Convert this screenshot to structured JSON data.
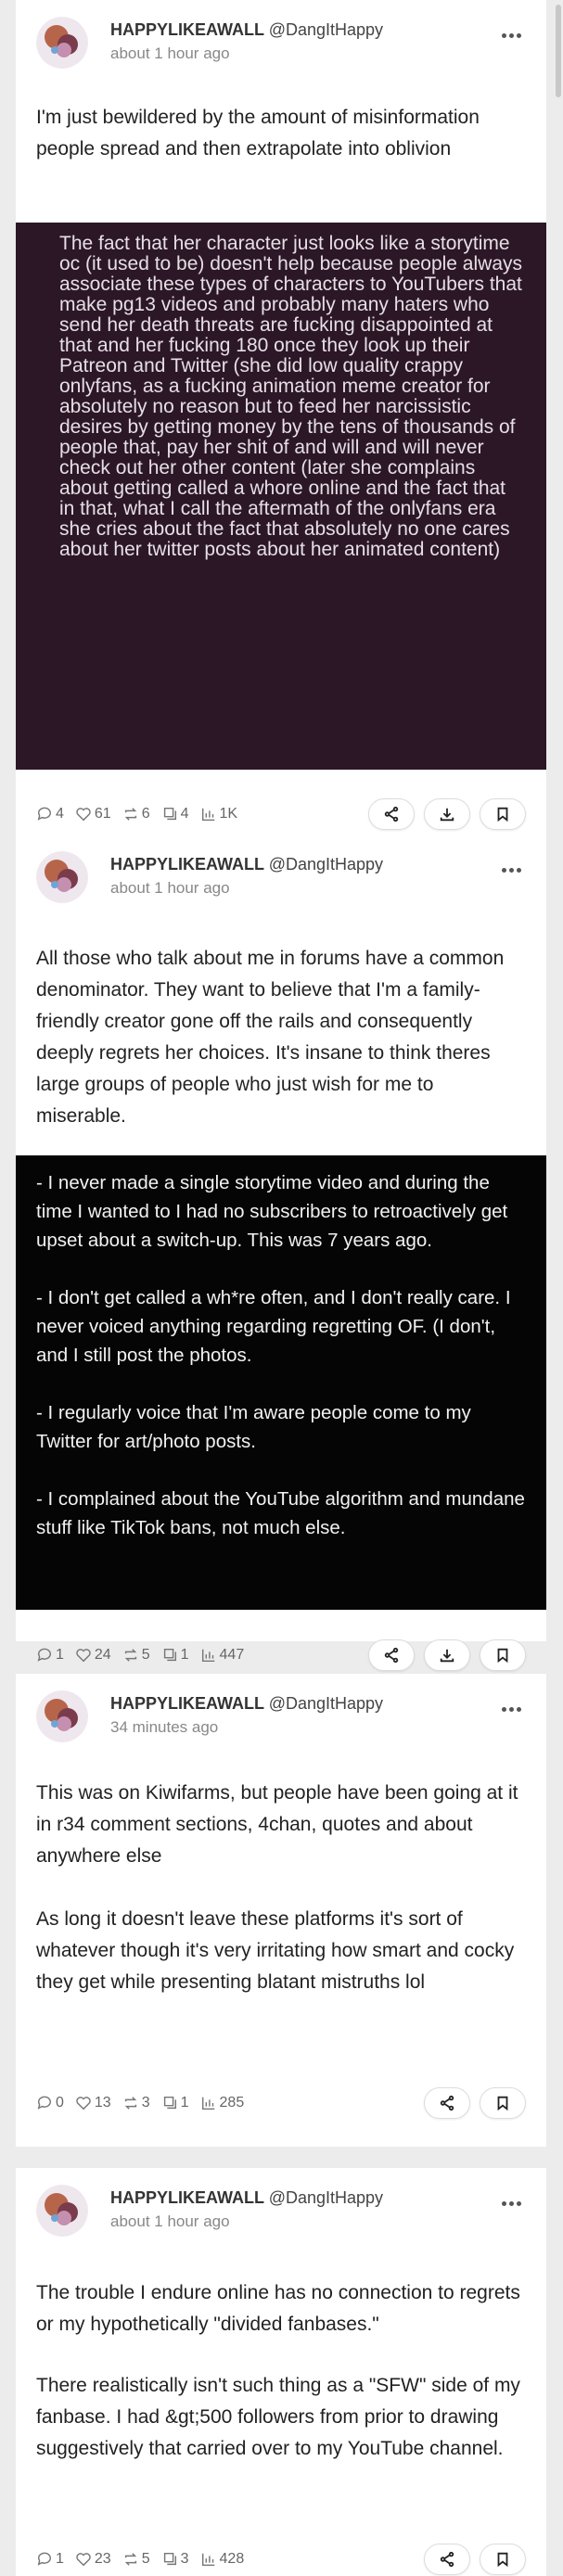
{
  "posts": [
    {
      "username": "HAPPYLIKEAWALL",
      "handle": "@DangItHappy",
      "timestamp": "about 1 hour ago",
      "text": "I'm just bewildered by the amount of misinformation people spread and then extrapolate into oblivion",
      "quote": [
        "The fact that her character just looks like a storytime oc (it used to be) doesn't help because people always associate these types of characters to YouTubers that make pg13 videos and probably many haters who send her death threats are fucking disappointed at that and her fucking 180 once they look up their Patreon and Twitter (she did low quality crappy onlyfans, as a fucking animation meme creator for absolutely no reason but to feed her narcissistic desires by getting money by the tens of thousands of people that, pay her shit of and will and will never check out her other content (later she complains about getting called a whore online and the fact that in that, what I call the aftermath of the onlyfans era she cries about the fact that absolutely no one cares about her twitter posts about her animated content)"
      ],
      "stats": {
        "replies": "4",
        "likes": "61",
        "reposts": "6",
        "quotes": "4",
        "views": "1K"
      },
      "has_download": true
    },
    {
      "username": "HAPPYLIKEAWALL",
      "handle": "@DangItHappy",
      "timestamp": "about 1 hour ago",
      "text": "All those who talk about me in forums have a common denominator. They want to believe that I'm a family-friendly creator gone off the rails and consequently deeply regrets her choices. It's insane to think theres large groups of people who just wish for me to miserable.",
      "quote": [
        "- I never made a single storytime video and during the time I wanted to I had no subscribers to retroactively get upset about a switch-up. This was 7 years ago.",
        "- I don't get called a wh*re often, and I don't really care. I never voiced anything regarding regretting OF. (I don't, and I still post the photos.",
        "- I regularly voice that I'm aware people come to my Twitter for art/photo posts.",
        "- I complained about the YouTube algorithm and mundane stuff like TikTok bans, not much else."
      ],
      "stats": {
        "replies": "1",
        "likes": "24",
        "reposts": "5",
        "quotes": "1",
        "views": "447"
      },
      "has_download": true
    },
    {
      "username": "HAPPYLIKEAWALL",
      "handle": "@DangItHappy",
      "timestamp": "34 minutes ago",
      "text": "This was on Kiwifarms, but people have been going at it in r34 comment sections, 4chan, quotes and about anywhere else",
      "text2": "As long it doesn't leave these platforms it's sort of whatever though it's very irritating how smart and cocky they get while presenting blatant mistruths lol",
      "stats": {
        "replies": "0",
        "likes": "13",
        "reposts": "3",
        "quotes": "1",
        "views": "285"
      },
      "has_download": false
    },
    {
      "username": "HAPPYLIKEAWALL",
      "handle": "@DangItHappy",
      "timestamp": "about 1 hour ago",
      "text": "The trouble I endure online has no connection to regrets or my hypothetically \"divided fanbases.\"",
      "text2": "There realistically isn't such thing as a \"SFW\" side of my fanbase. I had &gt;500 followers from prior to drawing suggestively that carried over to my YouTube channel.",
      "stats": {
        "replies": "1",
        "likes": "23",
        "reposts": "5",
        "quotes": "3",
        "views": "428"
      },
      "has_download": false
    }
  ],
  "icons": {
    "reply": "reply-icon",
    "like": "heart-icon",
    "repost": "repost-icon",
    "quote": "quote-icon",
    "views": "views-icon",
    "share": "share-icon",
    "download": "download-icon",
    "bookmark": "bookmark-icon",
    "menu": "more-options-icon"
  },
  "colors": {
    "quote_bg_1": "#2c1726",
    "quote_bg_2": "#050505"
  }
}
